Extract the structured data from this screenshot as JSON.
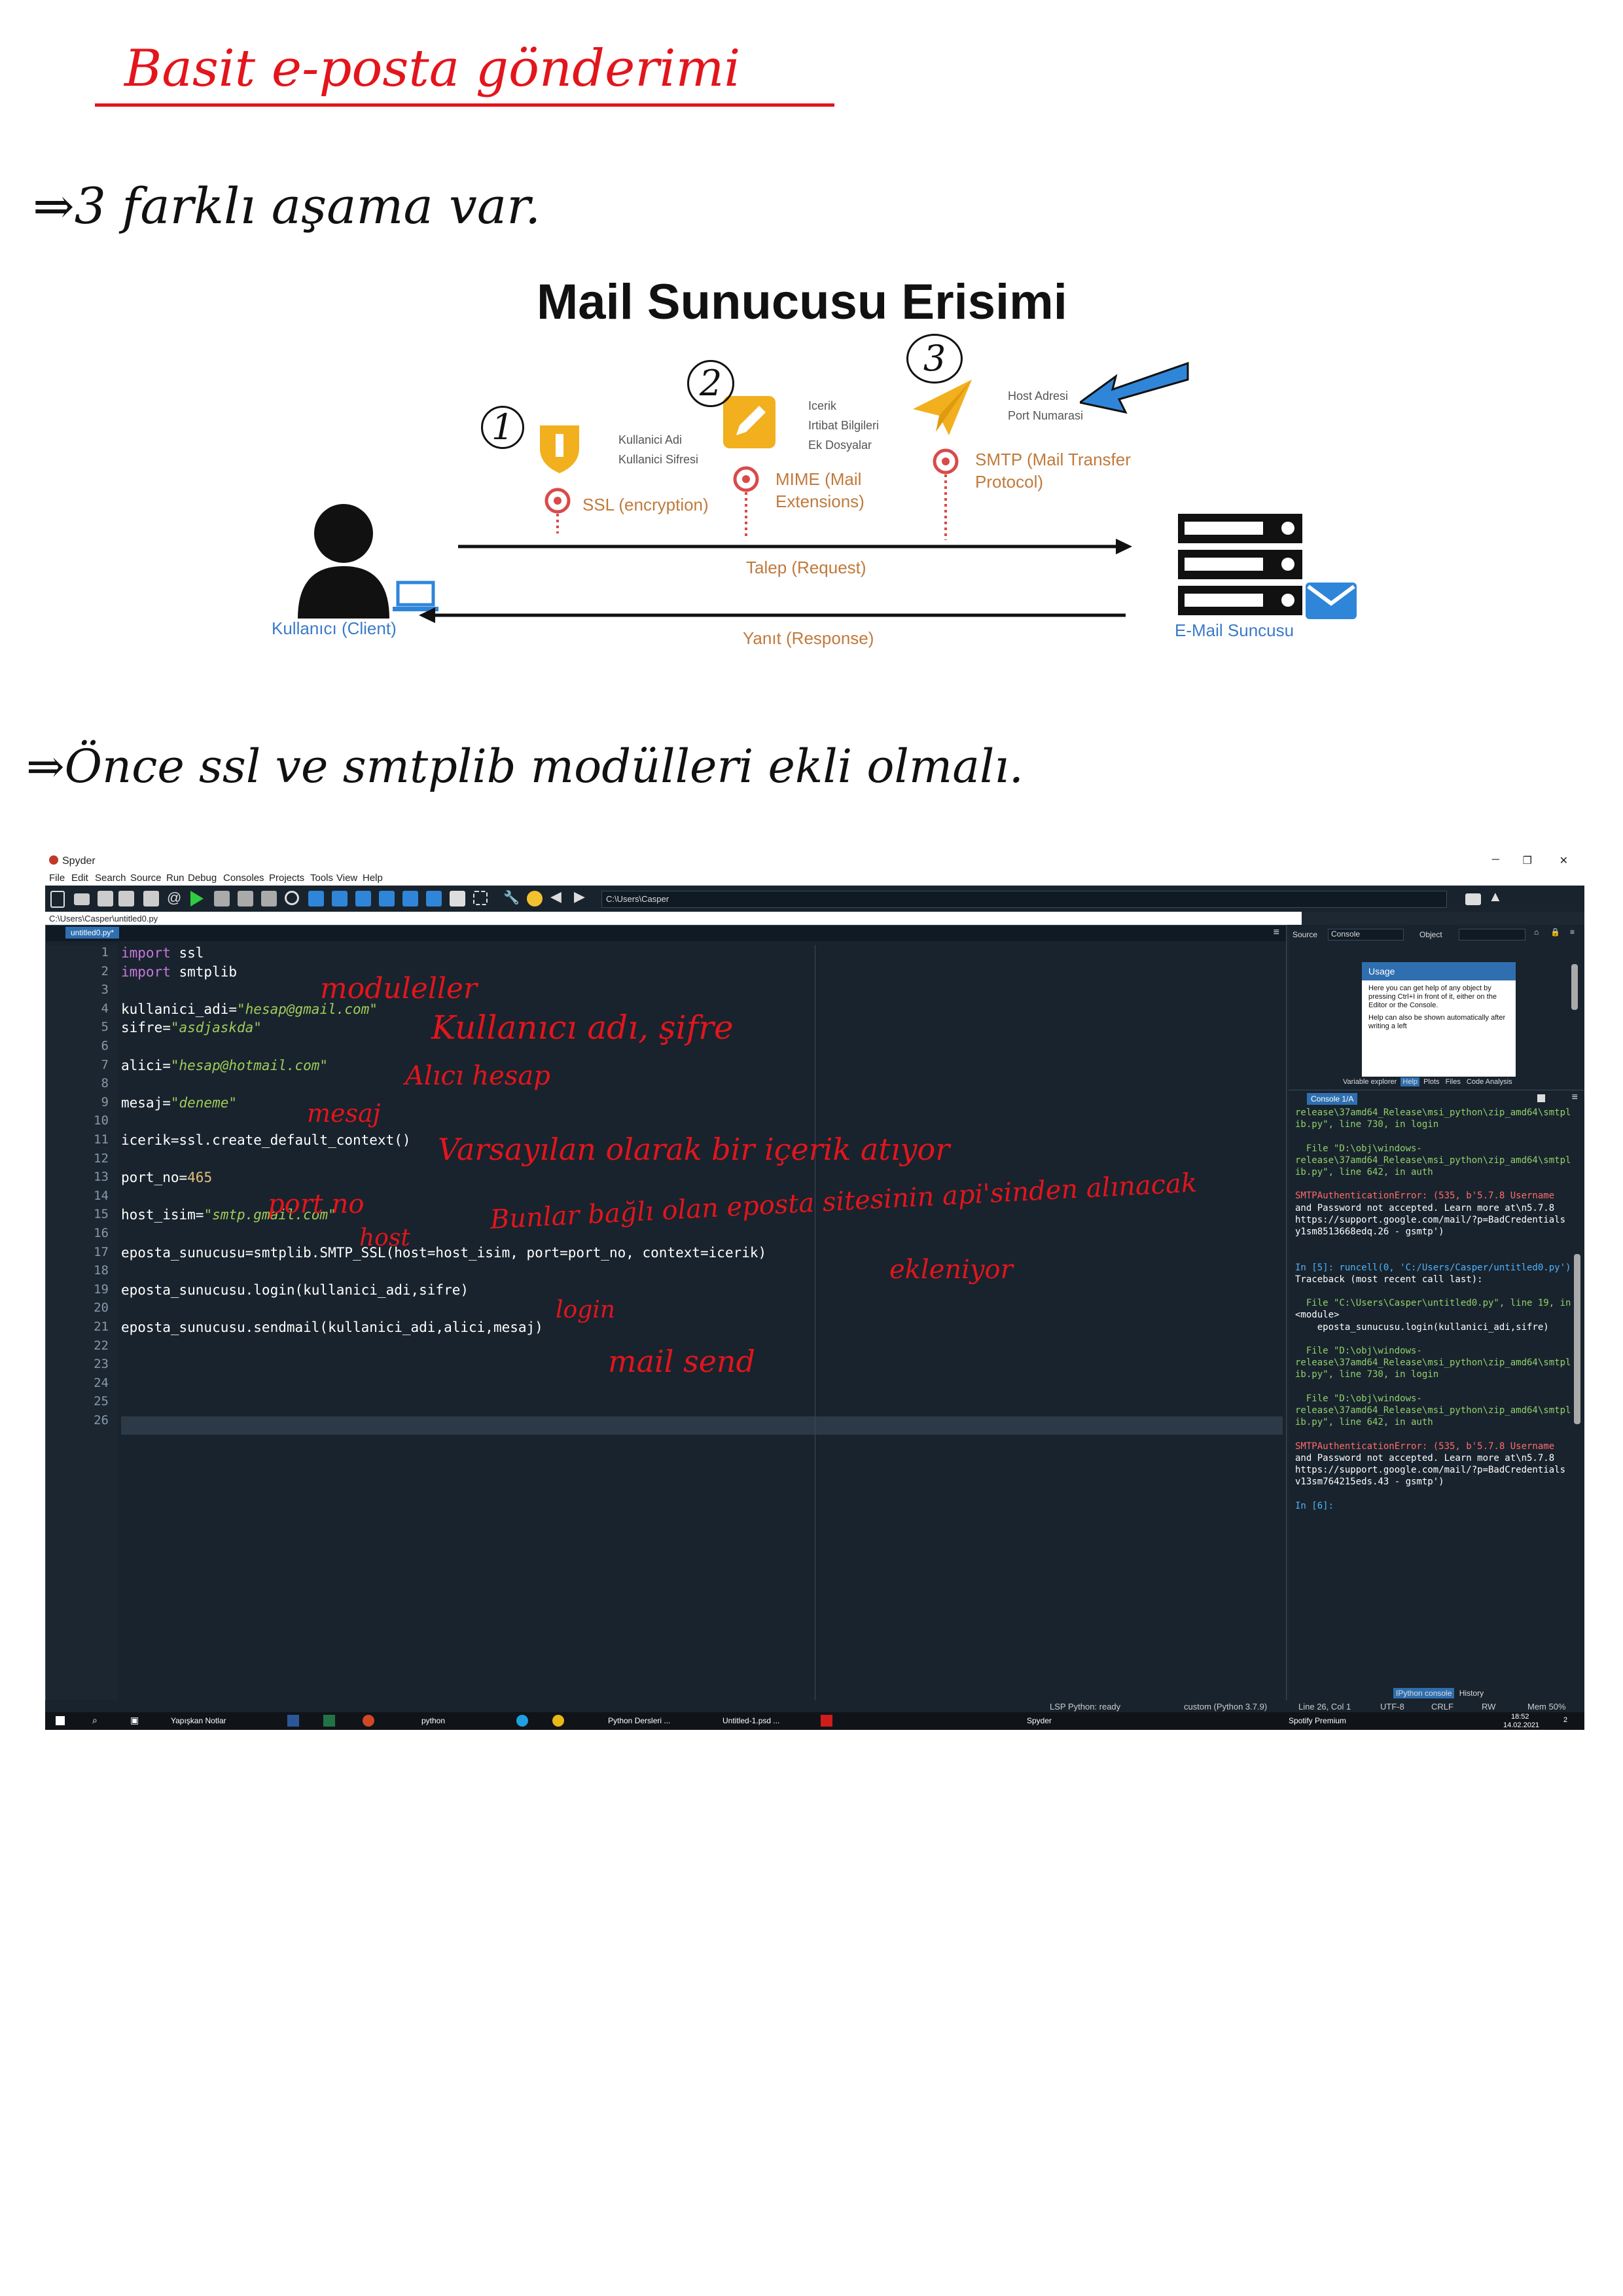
{
  "notes": {
    "title": "Basit e-posta gönderimi",
    "line1": "⇒3 farklı aşama var.",
    "line2": "⇒Önce ssl ve smtplib modülleri ekli olmalı."
  },
  "diagram": {
    "title": "Mail Sunucusu Erisimi",
    "client_label": "Kullanıcı (Client)",
    "server_label": "E-Mail Suncusu",
    "request_label": "Talep (Request)",
    "response_label": "Yanıt (Response)",
    "ssl": {
      "label": "SSL (encryption)",
      "items": [
        "Kullanici Adi",
        "Kullanici Sifresi"
      ],
      "marker": "1"
    },
    "mime": {
      "label": "MIME (Mail\nExtensions)",
      "items": [
        "Icerik",
        "Irtibat Bilgileri",
        "Ek Dosyalar"
      ],
      "marker": "2"
    },
    "smtp": {
      "label": "SMTP (Mail Transfer\nProtocol)",
      "items": [
        "Host Adresi",
        "Port Numarasi"
      ],
      "marker": "3"
    }
  },
  "spyder": {
    "window_title": "Spyder",
    "menu": [
      "File",
      "Edit",
      "Search",
      "Source",
      "Run",
      "Debug",
      "Consoles",
      "Projects",
      "Tools",
      "View",
      "Help"
    ],
    "toolbar_path": "C:\\Users\\Casper",
    "file_path": "C:\\Users\\Casper\\untitled0.py",
    "tab": "untitled0.py*",
    "code_lines": [
      {
        "n": "1",
        "t": "import ssl"
      },
      {
        "n": "2",
        "t": "import smtplib"
      },
      {
        "n": "3",
        "t": ""
      },
      {
        "n": "4",
        "t": "kullanici_adi=\"hesap@gmail.com\""
      },
      {
        "n": "5",
        "t": "sifre=\"asdjaskda\""
      },
      {
        "n": "6",
        "t": ""
      },
      {
        "n": "7",
        "t": "alici=\"hesap@hotmail.com\""
      },
      {
        "n": "8",
        "t": ""
      },
      {
        "n": "9",
        "t": "mesaj=\"deneme\""
      },
      {
        "n": "10",
        "t": ""
      },
      {
        "n": "11",
        "t": "icerik=ssl.create_default_context()"
      },
      {
        "n": "12",
        "t": ""
      },
      {
        "n": "13",
        "t": "port_no=465"
      },
      {
        "n": "14",
        "t": ""
      },
      {
        "n": "15",
        "t": "host_isim=\"smtp.gmail.com\""
      },
      {
        "n": "16",
        "t": ""
      },
      {
        "n": "17",
        "t": "eposta_sunucusu=smtplib.SMTP_SSL(host=host_isim, port=port_no, context=icerik)"
      },
      {
        "n": "18",
        "t": ""
      },
      {
        "n": "19",
        "t": "eposta_sunucusu.login(kullanici_adi,sifre)"
      },
      {
        "n": "20",
        "t": ""
      },
      {
        "n": "21",
        "t": "eposta_sunucusu.sendmail(kullanici_adi,alici,mesaj)"
      },
      {
        "n": "22",
        "t": ""
      },
      {
        "n": "23",
        "t": ""
      },
      {
        "n": "24",
        "t": ""
      },
      {
        "n": "25",
        "t": ""
      },
      {
        "n": "26",
        "t": ""
      }
    ],
    "annotations": {
      "a1": "moduleller",
      "a2": "Kullanıcı adı, şifre",
      "a3": "Alıcı hesap",
      "a4": "mesaj",
      "a5": "Varsayılan olarak bir içerik atıyor",
      "a6": "port no",
      "a7": "host",
      "a8": "Bunlar bağlı olan eposta sitesinin api'sinden alınacak",
      "a9": "ekleniyor",
      "a10": "login",
      "a11": "mail send"
    },
    "help": {
      "source_label": "Source",
      "source_value": "Console",
      "object_label": "Object",
      "usage_title": "Usage",
      "usage_text1": "Here you can get help of any object by pressing Ctrl+I in front of it, either on the Editor or the Console.",
      "usage_text2": "Help can also be shown automatically after writing a left",
      "tabs": [
        "Variable explorer",
        "Help",
        "Plots",
        "Files",
        "Code Analysis"
      ]
    },
    "console": {
      "tab": "Console 1/A",
      "lines": [
        "release\\37amd64_Release\\msi_python\\zip_amd64\\smtpl",
        "ib.py\", line 730, in login",
        "",
        "  File \"D:\\obj\\windows-",
        "release\\37amd64_Release\\msi_python\\zip_amd64\\smtpl",
        "ib.py\", line 642, in auth",
        "",
        "SMTPAuthenticationError: (535, b'5.7.8 Username",
        "and Password not accepted. Learn more at\\n5.7.8",
        "https://support.google.com/mail/?p=BadCredentials",
        "y1sm8513668edq.26 - gsmtp')",
        "",
        "",
        "In [5]: runcell(0, 'C:/Users/Casper/untitled0.py')",
        "Traceback (most recent call last):",
        "",
        "  File \"C:\\Users\\Casper\\untitled0.py\", line 19, in",
        "<module>",
        "    eposta_sunucusu.login(kullanici_adi,sifre)",
        "",
        "  File \"D:\\obj\\windows-",
        "release\\37amd64_Release\\msi_python\\zip_amd64\\smtpl",
        "ib.py\", line 730, in login",
        "",
        "  File \"D:\\obj\\windows-",
        "release\\37amd64_Release\\msi_python\\zip_amd64\\smtpl",
        "ib.py\", line 642, in auth",
        "",
        "SMTPAuthenticationError: (535, b'5.7.8 Username",
        "and Password not accepted. Learn more at\\n5.7.8",
        "https://support.google.com/mail/?p=BadCredentials",
        "v13sm764215eds.43 - gsmtp')",
        "",
        "In [6]:"
      ],
      "bottom_tabs": [
        "IPython console",
        "History"
      ]
    },
    "status": {
      "lsp": "LSP Python: ready",
      "env": "custom (Python 3.7.9)",
      "pos": "Line 26, Col 1",
      "enc": "UTF-8",
      "eol": "CRLF",
      "rw": "RW",
      "mem": "Mem 50%"
    },
    "taskbar": {
      "items": [
        "Yapışkan Notlar",
        "python",
        "Python Dersleri ...",
        "Untitled-1.psd ...",
        "Spyder",
        "Spotify Premium"
      ],
      "time": "18:52",
      "date": "14.02.2021",
      "notif": "2"
    }
  }
}
